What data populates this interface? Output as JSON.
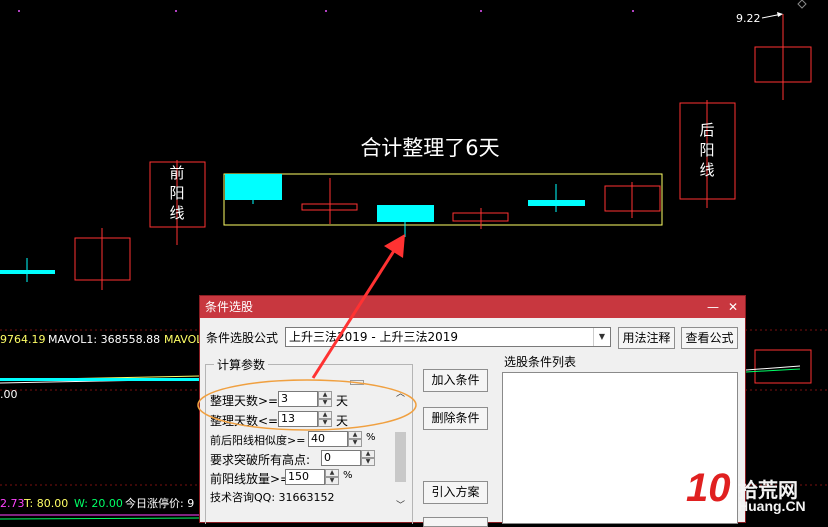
{
  "chart": {
    "price_label": "9.22",
    "annotation_title": "合计整理了6天",
    "front_line_label": [
      "前",
      "阳",
      "线"
    ],
    "back_line_label": [
      "后",
      "阳",
      "线"
    ],
    "indicator_row": {
      "value1": "9764.19",
      "mavol1": "MAVOL1: 368558.88",
      "mavol2": "MAVOL"
    },
    "lower_value": ".00",
    "bottom_row": {
      "a": "2.73",
      "t": "T: 80.00",
      "w": "W: 20.00",
      "limit": "今日涨停价: 9"
    },
    "colors": {
      "bull": "#ff3232",
      "bear": "#00ffff",
      "box": "#ffff66",
      "arrow": "#ff3232",
      "ellipse": "#f0a040"
    }
  },
  "dialog": {
    "title": "条件选股",
    "minimize": "—",
    "close": "✕",
    "formula_label": "条件选股公式",
    "formula_value": "上升三法2019 - 上升三法2019",
    "annotate_button": "用法注释",
    "view_button": "查看公式",
    "params_group": "计算参数",
    "params": [
      {
        "label": "整理天数>=",
        "value": "3",
        "unit": "天"
      },
      {
        "label": "整理天数<=",
        "value": "13",
        "unit": "天"
      },
      {
        "label": "前后阳线相似度>=",
        "value": "40",
        "unit": "%"
      },
      {
        "label": "要求突破所有高点:",
        "value": "0",
        "unit": ""
      },
      {
        "label": "前阳线放量>=",
        "value": "150",
        "unit": "%"
      }
    ],
    "consult": "技术咨询QQ: 31663152",
    "add_condition": "加入条件",
    "delete_condition": "删除条件",
    "import_plan": "引入方案",
    "list_label": "选股条件列表"
  },
  "watermark": {
    "number": "10",
    "brand_cn": "拾荒网",
    "brand_en": "Huang.CN"
  }
}
